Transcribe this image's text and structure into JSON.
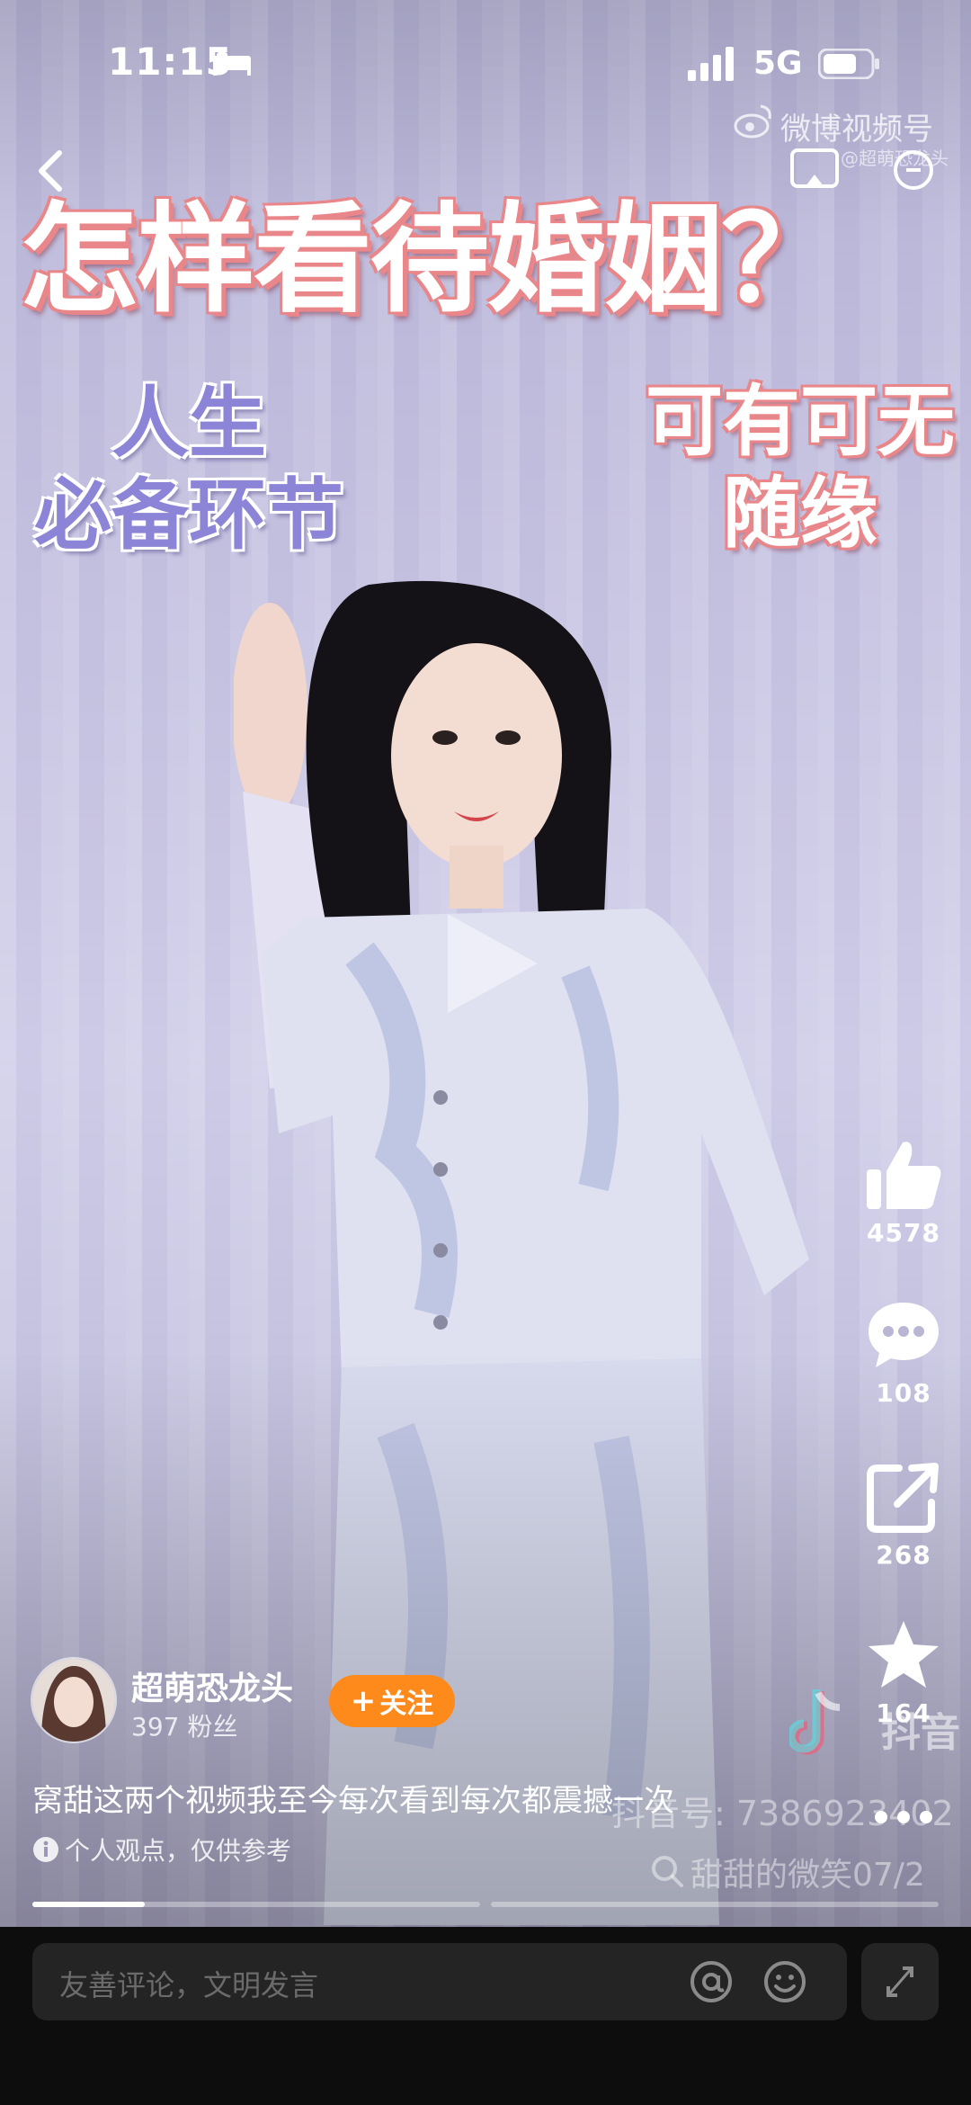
{
  "status_bar": {
    "time": "11:15",
    "network": "5G"
  },
  "watermark": {
    "brand": "微博视频号",
    "sub": "@超萌恐龙头"
  },
  "video": {
    "title": "怎样看待婚姻？",
    "label_left": [
      "人生",
      "必备环节"
    ],
    "label_right": [
      "可有可无",
      "随缘"
    ]
  },
  "actions": {
    "like_count": "4578",
    "comment_count": "108",
    "share_count": "268",
    "favorite_count": "164"
  },
  "douyin": {
    "logo_text": "抖音",
    "id_text": "抖音号: 7386923402",
    "search_text": "甜甜的微笑07/2"
  },
  "author": {
    "name": "超萌恐龙头",
    "fans": "397 粉丝",
    "follow_label": "关注"
  },
  "caption": "窝甜这两个视频我至今每次看到每次都震撼一次",
  "disclaimer": "个人观点，仅供参考",
  "progress": {
    "segment1_fraction": 0.25,
    "segment2_fraction": 0
  },
  "comment_input": {
    "placeholder": "友善评论，文明发言"
  },
  "colors": {
    "follow": "#ff8a1c",
    "title_outline": "#e9868a",
    "label_purple": "#8c84d6"
  }
}
